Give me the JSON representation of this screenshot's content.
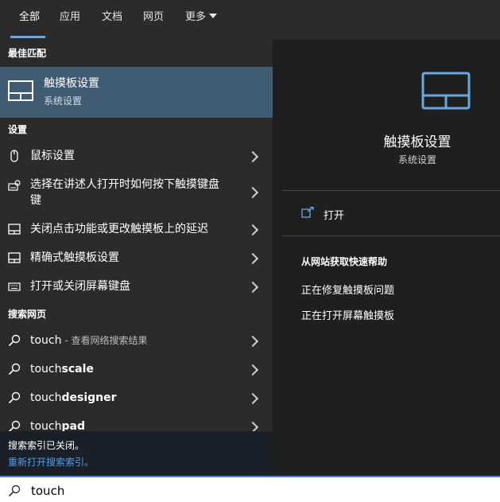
{
  "tabs": [
    {
      "label": "全部"
    },
    {
      "label": "应用"
    },
    {
      "label": "文档"
    },
    {
      "label": "网页"
    },
    {
      "label": "更多"
    }
  ],
  "sections": {
    "best_match": "最佳匹配",
    "settings": "设置",
    "web": "搜索网页"
  },
  "best_match": {
    "title": "触摸板设置",
    "subtitle": "系统设置"
  },
  "settings_items": [
    {
      "label": "鼠标设置",
      "icon": "mouse-icon"
    },
    {
      "label": "选择在讲述人打开时如何按下触摸键盘键",
      "icon": "narrator-keyboard-icon"
    },
    {
      "label": "关闭点击功能或更改触摸板上的延迟",
      "icon": "touchpad-icon"
    },
    {
      "label": "精确式触摸板设置",
      "icon": "touchpad-icon"
    },
    {
      "label": "打开或关闭屏幕键盘",
      "icon": "keyboard-icon"
    }
  ],
  "web_items": [
    {
      "prefix": "touch",
      "suffix": "",
      "hint": " - 查看网络搜索结果"
    },
    {
      "prefix": "touch",
      "suffix": "scale",
      "hint": ""
    },
    {
      "prefix": "touch",
      "suffix": "designer",
      "hint": ""
    },
    {
      "prefix": "touch",
      "suffix": "pad",
      "hint": ""
    }
  ],
  "status": {
    "text": "搜索索引已关闭。",
    "link": "重新打开搜索索引。"
  },
  "detail": {
    "title": "触摸板设置",
    "subtitle": "系统设置",
    "open_label": "打开",
    "help_heading": "从网站获取快速帮助",
    "help_links": [
      "正在修复触摸板问题",
      "正在打开屏幕触摸板"
    ]
  },
  "search": {
    "query": "touch"
  },
  "colors": {
    "accent": "#66a9e0",
    "selected_bg": "#3f5c73",
    "link": "#4aa0e6"
  }
}
